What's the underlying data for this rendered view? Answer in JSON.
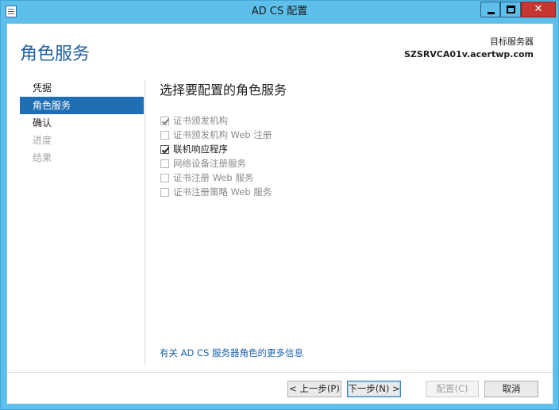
{
  "window": {
    "title": "AD CS 配置",
    "minimize_symbol": "",
    "maximize_symbol": "",
    "close_symbol": "✕"
  },
  "header": {
    "page_title": "角色服务",
    "target_label": "目标服务器",
    "target_value": "SZSRVCA01v.acertwp.com"
  },
  "nav": {
    "items": [
      {
        "label": "凭据",
        "state": "normal"
      },
      {
        "label": "角色服务",
        "state": "active"
      },
      {
        "label": "确认",
        "state": "normal"
      },
      {
        "label": "进度",
        "state": "disabled"
      },
      {
        "label": "结果",
        "state": "disabled"
      }
    ]
  },
  "main": {
    "section_title": "选择要配置的角色服务",
    "roles": [
      {
        "label": "证书颁发机构",
        "checked": true,
        "enabled": false
      },
      {
        "label": "证书颁发机构 Web 注册",
        "checked": false,
        "enabled": false
      },
      {
        "label": "联机响应程序",
        "checked": true,
        "enabled": true
      },
      {
        "label": "网络设备注册服务",
        "checked": false,
        "enabled": false
      },
      {
        "label": "证书注册 Web 服务",
        "checked": false,
        "enabled": false
      },
      {
        "label": "证书注册策略 Web 服务",
        "checked": false,
        "enabled": false
      }
    ],
    "more_info_link": "有关 AD CS 服务器角色的更多信息"
  },
  "footer": {
    "prev_label": "< 上一步(P)",
    "next_label": "下一步(N) >",
    "config_label": "配置(C)",
    "cancel_label": "取消"
  },
  "colors": {
    "title_bar": "#5ec0ea",
    "accent": "#1f6fb5",
    "page_title": "#1f5fa8",
    "close_button": "#c7372f",
    "link": "#1c61a6"
  }
}
